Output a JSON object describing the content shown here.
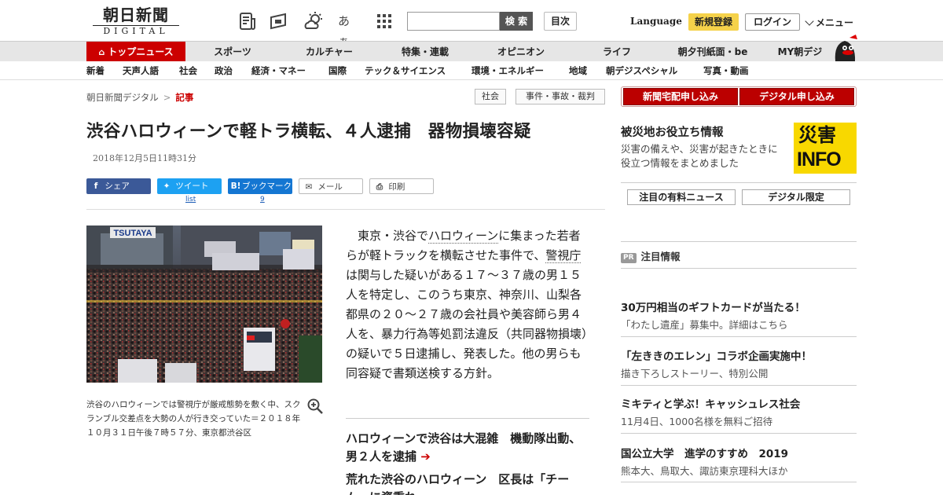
{
  "header": {
    "logo_main": "朝日新聞",
    "logo_sub": "DIGITAL",
    "search_button": "検 索",
    "index_button": "目次",
    "language": "Language",
    "register": "新規登録",
    "login": "ログイン",
    "menu": "メニュー",
    "icons": [
      "news-icon",
      "flag-icon",
      "weather-icon",
      "font-size-icon",
      "grid-icon"
    ],
    "font_icon_text": "あぁ"
  },
  "nav_primary": [
    "トップニュース",
    "スポーツ",
    "カルチャー",
    "特集・連載",
    "オピニオン",
    "ライフ",
    "朝夕刊紙面・be",
    "MY朝デジ"
  ],
  "nav_secondary": [
    "新着",
    "天声人語",
    "社会",
    "政治",
    "経済・マネー",
    "国際",
    "テック＆サイエンス",
    "環境・エネルギー",
    "地域",
    "朝デジスペシャル",
    "写真・動画"
  ],
  "breadcrumb": {
    "home": "朝日新聞デジタル",
    "sep": ">",
    "current": "記事"
  },
  "tags": [
    "社会",
    "事件・事故・裁判"
  ],
  "article": {
    "headline": "渋谷ハロウィーンで軽トラ横転、４人逮捕　器物損壊容疑",
    "date": "2018年12月5日11時31分",
    "share": {
      "facebook": "シェア",
      "twitter": "ツイート",
      "hatena": "ブックマーク",
      "mail": "メール",
      "print": "印刷",
      "twitter_count": "list",
      "hatena_count": "9"
    },
    "photo_sign": "TSUTAYA",
    "caption": "渋谷のハロウィーンでは警視庁が厳戒態勢を敷く中、スクランブル交差点を大勢の人が行き交っていた＝２０１８年１０月３１日午後７時５７分、東京都渋谷区",
    "body_1": "東京・渋谷で",
    "body_kw1": "ハロウィーン",
    "body_2": "に集まった若者らが軽トラックを横転させた事件で、",
    "body_kw2": "警視庁",
    "body_3": "は関与した疑いがある１７～３７歳の男１５人を特定し、このうち東京、神奈川、山梨各都県の２０～２７歳の会社員や美容師ら男４人を、暴力行為等処罰法違反（共同器物損壊）の疑いで５日逮捕し、発表した。他の男らも同容疑で書類送検する方針。",
    "related": [
      "ハロウィーンで渋谷は大混雑　機動隊出動、男２人を逮捕",
      "荒れた渋谷のハロウィーン　区長は「チーム…に資重れ"
    ]
  },
  "sidebar": {
    "subscribe_paper": "新聞宅配申し込み",
    "subscribe_digital": "デジタル申し込み",
    "disaster_title": "被災地お役立ち情報",
    "disaster_desc": "災害の備えや、災害が起きたときに役立つ情報をまとめました",
    "disaster_logo_top": "災害",
    "disaster_logo_bottom": "INFO",
    "pick_paid": "注目の有料ニュース",
    "pick_digital": "デジタル限定",
    "pr_badge": "PR",
    "pr_label": "注目情報",
    "pr_items": [
      {
        "title": "30万円相当のギフトカードが当たる！",
        "desc": "「わたし遺産」募集中。詳細はこちら"
      },
      {
        "title": "「左ききのエレン」コラボ企画実施中！",
        "desc": "描き下ろしストーリー、特別公開"
      },
      {
        "title": "ミキティと学ぶ！キャッシュレス社会",
        "desc": "11月4日、1000名様を無料ご招待"
      },
      {
        "title": "国公立大学　進学のすすめ　2019",
        "desc": "熊本大、鳥取大、諏訪東京理科大ほか"
      }
    ]
  },
  "colors": {
    "accent": "#cc0000",
    "register": "#f5d24a",
    "facebook": "#3b5998",
    "twitter": "#1da1f2",
    "hatena": "#1476d2",
    "disaster": "#f8d800"
  }
}
